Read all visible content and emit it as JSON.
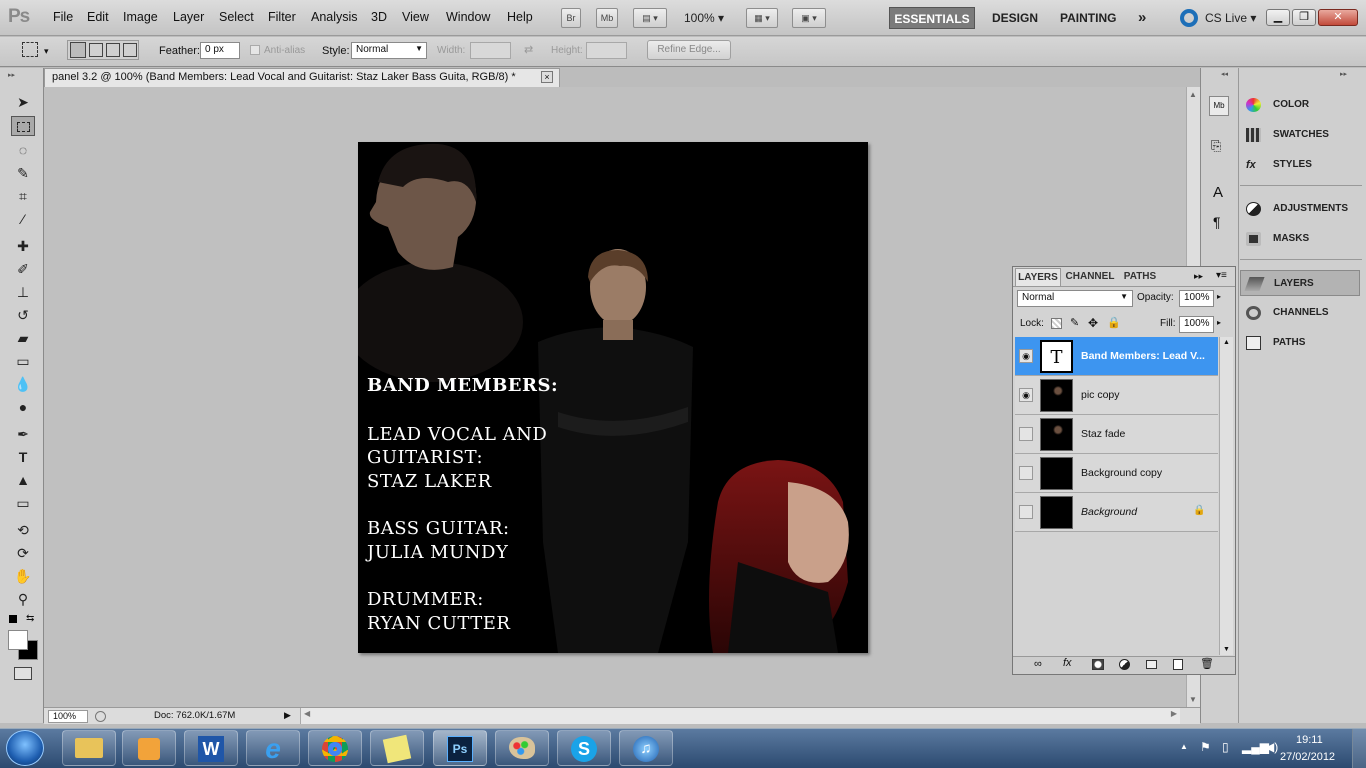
{
  "menubar": {
    "logo": "Ps",
    "items": [
      "File",
      "Edit",
      "Image",
      "Layer",
      "Select",
      "Filter",
      "Analysis",
      "3D",
      "View",
      "Window",
      "Help"
    ],
    "bridge": "Br",
    "minibridge": "Mb",
    "zoom": "100%",
    "workspaces": [
      "ESSENTIALS",
      "DESIGN",
      "PAINTING"
    ],
    "more": "»",
    "cslive": "CS Live"
  },
  "options": {
    "feather_label": "Feather:",
    "feather_value": "0 px",
    "antialias_label": "Anti-alias",
    "style_label": "Style:",
    "style_value": "Normal",
    "width_label": "Width:",
    "height_label": "Height:",
    "refine_label": "Refine Edge..."
  },
  "document": {
    "tab_title": "panel 3.2 @ 100% (Band Members:  Lead Vocal and Guitarist: Staz Laker  Bass Guita, RGB/8) *",
    "close": "×",
    "zoom_status": "100%",
    "doc_size": "Doc: 762.0K/1.67M"
  },
  "artwork": {
    "heading": "BAND MEMBERS:",
    "lines": [
      "LEAD VOCAL AND",
      "GUITARIST:",
      "STAZ LAKER",
      "BASS GUITAR:",
      "JULIA MUNDY",
      "DRUMMER:",
      "RYAN CUTTER"
    ]
  },
  "dock": {
    "items": [
      "COLOR",
      "SWATCHES",
      "STYLES",
      "ADJUSTMENTS",
      "MASKS",
      "LAYERS",
      "CHANNELS",
      "PATHS"
    ]
  },
  "layers_panel": {
    "tabs": [
      "LAYERS",
      "CHANNEL",
      "PATHS"
    ],
    "blend_mode": "Normal",
    "opacity_label": "Opacity:",
    "opacity_value": "100%",
    "lock_label": "Lock:",
    "fill_label": "Fill:",
    "fill_value": "100%",
    "layers": [
      {
        "name": "Band Members:  Lead V...",
        "visible": true,
        "type": "text",
        "selected": true
      },
      {
        "name": "pic copy",
        "visible": true,
        "type": "image",
        "selected": false
      },
      {
        "name": "Staz fade",
        "visible": false,
        "type": "image",
        "selected": false
      },
      {
        "name": "Background copy",
        "visible": false,
        "type": "fill",
        "selected": false
      },
      {
        "name": "Background",
        "visible": false,
        "type": "fill",
        "selected": false,
        "locked": true
      }
    ]
  },
  "taskbar": {
    "time": "19:11",
    "date": "27/02/2012"
  },
  "colors": {
    "selection": "#3d95f0",
    "canvas_bg": "#000000",
    "workspace_active": "#7b7b7b"
  }
}
